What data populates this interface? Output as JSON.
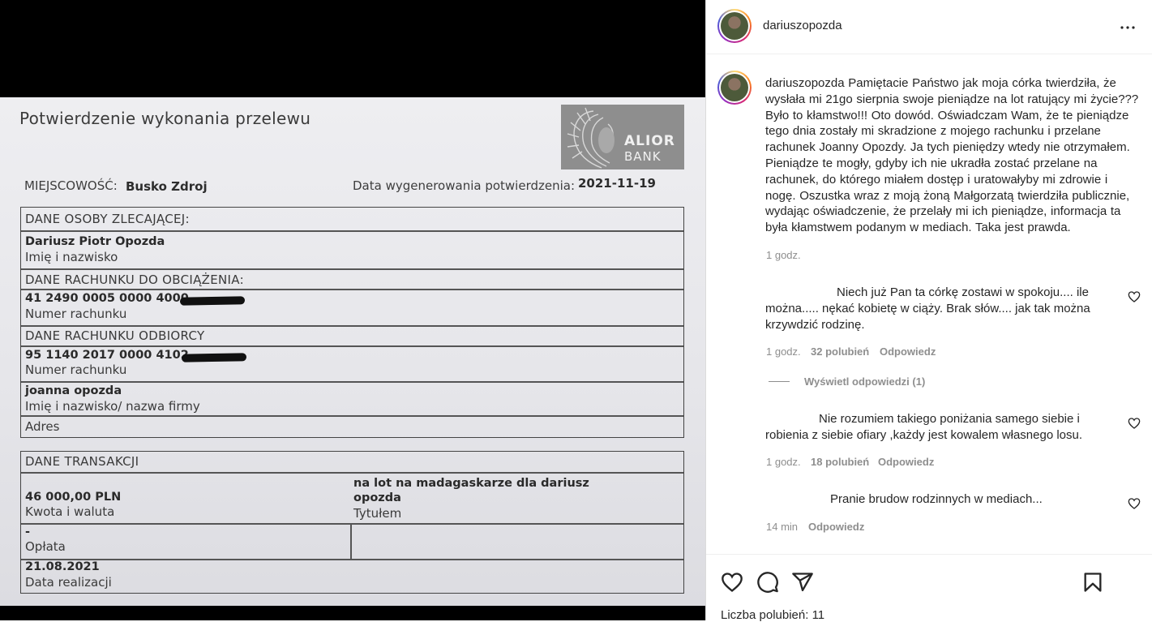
{
  "document": {
    "title": "Potwierdzenie wykonania przelewu",
    "bank_logo": {
      "line1": "ALIOR",
      "line2": "BANK"
    },
    "city_label": "MIEJSCOWOŚĆ:",
    "city_value": "Busko Zdroj",
    "generated_label": "Data wygenerowania potwierdzenia:",
    "generated_value": "2021-11-19",
    "payer": {
      "section": "DANE OSOBY ZLECAJĄCEJ:",
      "name": "Dariusz Piotr Opozda",
      "name_label": "Imię i nazwisko"
    },
    "debit_account": {
      "section": "DANE RACHUNKU DO OBCIĄŻENIA:",
      "number": "41 2490 0005 0000 4000",
      "label": "Numer rachunku"
    },
    "recipient_account": {
      "section": "DANE RACHUNKU ODBIORCY",
      "number": "95 1140 2017 0000 4102",
      "label": "Numer rachunku"
    },
    "recipient": {
      "name": "joanna opozda",
      "name_label": "Imię i nazwisko/ nazwa firmy",
      "address_label": "Adres"
    },
    "transaction": {
      "section": "DANE TRANSAKCJI",
      "amount": "46 000,00 PLN",
      "amount_label": "Kwota i waluta",
      "title_value_1": "na lot na madagaskarze dla dariusz",
      "title_value_2": "opozda",
      "title_label": "Tytułem",
      "fee_value": "-",
      "fee_label": "Opłata",
      "date_value": "21.08.2021",
      "date_label": "Data realizacji"
    }
  },
  "post": {
    "username": "dariuszopozda",
    "caption": "Pamiętacie Państwo jak moja córka twierdziła, że wysłała mi 21go sierpnia swoje pieniądze na lot ratujący mi życie??? Było to kłamstwo!!! Oto dowód. Oświadczam Wam, że te pieniądze tego dnia zostały mi skradzione z mojego rachunku i przelane rachunek Joanny Opozdy. Ja tych pieniędzy wtedy nie otrzymałem. Pieniądze te mogły, gdyby ich nie ukradła zostać przelane na rachunek, do którego miałem dostęp i uratowałyby mi zdrowie i nogę. Oszustka wraz z moją żoną Małgorzatą twierdziła publicznie, wydając oświadczenie, że przelały mi ich pieniądze, informacja ta była kłamstwem podanym w mediach. Taka jest prawda.",
    "caption_time": "1 godz."
  },
  "comments": [
    {
      "text": "Niech już Pan ta córkę zostawi w spokoju.... ile można..... nękać kobietę w ciąży. Brak słów.... jak tak można krzywdzić rodzinę.",
      "time": "1 godz.",
      "likes": "32 polubień",
      "reply": "Odpowiedz"
    },
    {
      "text": "Nie rozumiem takiego poniżania samego siebie i robienia z siebie ofiary ,każdy jest kowalem własnego losu.",
      "time": "1 godz.",
      "likes": "18 polubień",
      "reply": "Odpowiedz"
    },
    {
      "text": "Pranie brudow rodzinnych w mediach...",
      "time": "14 min",
      "reply": "Odpowiedz"
    }
  ],
  "view_replies": "Wyświetl odpowiedzi (1)",
  "likes_summary": "Liczba polubień: 11",
  "icons": [
    "more-icon",
    "heart-icon",
    "comment-icon",
    "share-icon",
    "bookmark-icon"
  ]
}
